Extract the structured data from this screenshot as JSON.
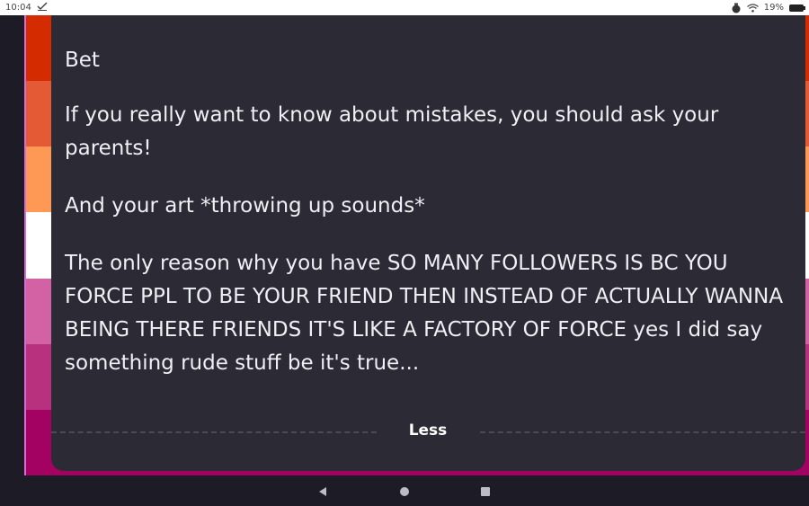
{
  "status_bar": {
    "time": "10:04",
    "battery_percent": "19%",
    "icons": [
      "check-icon",
      "alarm-icon",
      "wifi-icon",
      "battery-charging-icon"
    ]
  },
  "flag": {
    "stripe_colors": [
      "#d42c00",
      "#e45a35",
      "#fd9855",
      "#ffffff",
      "#d362a4",
      "#b8317e",
      "#a30262"
    ]
  },
  "post": {
    "paragraphs": [
      "Bet",
      "If you really want to know about mistakes, you should ask your parents!",
      "And your art *throwing up sounds*",
      "The only reason why you have SO MANY FOLLOWERS IS BC YOU FORCE PPL TO BE YOUR FRIEND THEN INSTEAD OF ACTUALLY WANNA BEING THERE FRIENDS IT'S LIKE A FACTORY OF FORCE yes I did say something rude stuff be it's true..."
    ],
    "less_label": "Less"
  },
  "nav_bar": {
    "icons": [
      "back-icon",
      "home-icon",
      "recents-icon"
    ]
  },
  "colors": {
    "card_bg": "#2b2a35",
    "page_bg": "#1d1c26",
    "text": "#f0eff4"
  }
}
